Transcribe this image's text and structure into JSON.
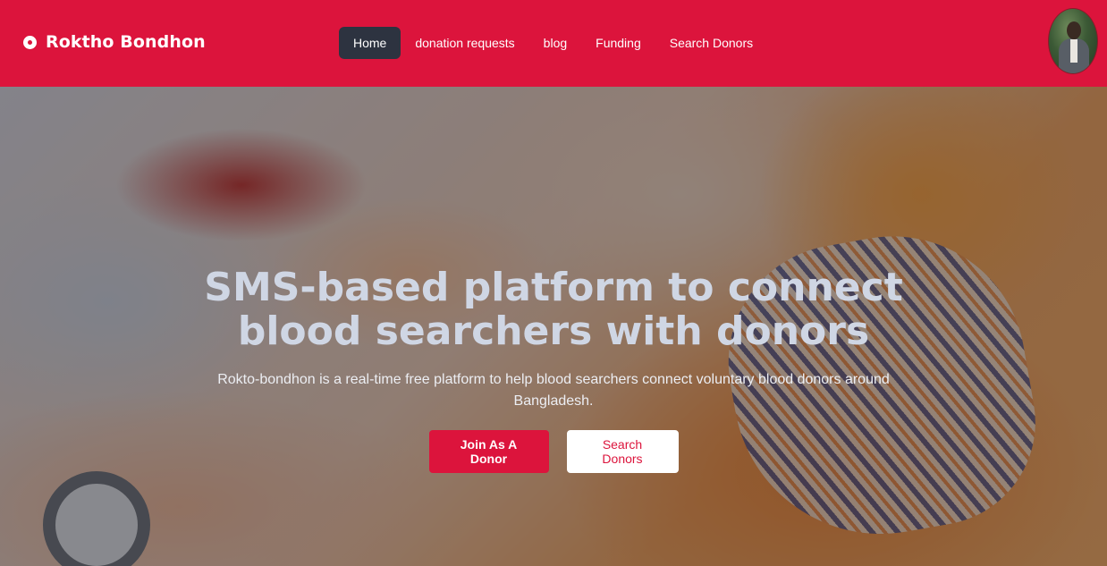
{
  "brand": {
    "name": "Roktho Bondhon",
    "icon": "blood-drop-icon"
  },
  "nav": {
    "items": [
      {
        "label": "Home",
        "active": true
      },
      {
        "label": "donation requests",
        "active": false
      },
      {
        "label": "blog",
        "active": false
      },
      {
        "label": "Funding",
        "active": false
      },
      {
        "label": "Search Donors",
        "active": false
      }
    ]
  },
  "user": {
    "avatar": "user-avatar"
  },
  "hero": {
    "title_line1": "SMS-based platform to connect",
    "title_line2": "blood searchers with donors",
    "subtitle": "Rokto-bondhon is a real-time free platform to help blood searchers connect voluntary blood donors around Bangladesh.",
    "primary_button": "Join As A Donor",
    "secondary_button": "Search Donors"
  },
  "colors": {
    "brand": "#dc143c",
    "active_nav": "#2d3340"
  }
}
